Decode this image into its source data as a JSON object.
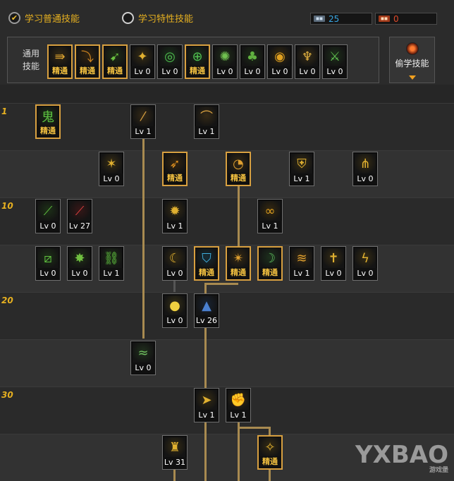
{
  "tabs": {
    "normal": "学习普通技能",
    "special": "学习特性技能"
  },
  "currency": [
    {
      "value": "25",
      "color": "#39a8e6"
    },
    {
      "value": "0",
      "color": "#e24a2a"
    }
  ],
  "common": {
    "label": "通用技能",
    "skills": [
      {
        "label": "精通",
        "gold": true,
        "icon": "dash-icon",
        "glyph": "⇛",
        "color": "#d8a030"
      },
      {
        "label": "精通",
        "gold": true,
        "icon": "crouch-icon",
        "glyph": "⤵",
        "color": "#c88020"
      },
      {
        "label": "精通",
        "gold": true,
        "icon": "kick-icon",
        "glyph": "➹",
        "color": "#6ac040"
      },
      {
        "label": "Lv 0",
        "gold": false,
        "icon": "wings-icon",
        "glyph": "✦",
        "color": "#e0b030"
      },
      {
        "label": "Lv 0",
        "gold": false,
        "icon": "target-icon",
        "glyph": "◎",
        "color": "#50c050"
      },
      {
        "label": "精通",
        "gold": true,
        "icon": "crosshair-icon",
        "glyph": "⊕",
        "color": "#50c050"
      },
      {
        "label": "Lv 0",
        "gold": false,
        "icon": "shout-icon",
        "glyph": "✺",
        "color": "#70c050"
      },
      {
        "label": "Lv 0",
        "gold": false,
        "icon": "mushroom-icon",
        "glyph": "♣",
        "color": "#60b040"
      },
      {
        "label": "Lv 0",
        "gold": false,
        "icon": "eye-icon",
        "glyph": "◉",
        "color": "#e0a020"
      },
      {
        "label": "Lv 0",
        "gold": false,
        "icon": "muscle-icon",
        "glyph": "♆",
        "color": "#e0b040"
      },
      {
        "label": "Lv 0",
        "gold": false,
        "icon": "spear-icon",
        "glyph": "⚔",
        "color": "#60c050"
      }
    ]
  },
  "steal": {
    "label": "偷学技能"
  },
  "level_markers": [
    "1",
    "10",
    "20",
    "30"
  ],
  "tree": [
    {
      "key": "r1c1",
      "label": "精通",
      "gold": true,
      "icon": "ghost-icon",
      "glyph": "鬼",
      "color": "#5cc040"
    },
    {
      "key": "r1c4",
      "label": "Lv 1",
      "gold": false,
      "icon": "claw-icon",
      "glyph": "⁄",
      "color": "#d8a040"
    },
    {
      "key": "r1c6",
      "label": "Lv 1",
      "gold": false,
      "icon": "slash-icon",
      "glyph": "⌒",
      "color": "#d8a040"
    },
    {
      "key": "r2c3",
      "label": "Lv 0",
      "gold": false,
      "icon": "fist-icon",
      "glyph": "✶",
      "color": "#e0b030"
    },
    {
      "key": "r2c5",
      "label": "精通",
      "gold": true,
      "icon": "sword-thrust-icon",
      "glyph": "➶",
      "color": "#e09020"
    },
    {
      "key": "r2c7",
      "label": "精通",
      "gold": true,
      "icon": "cyclone-icon",
      "glyph": "◔",
      "color": "#e0a030"
    },
    {
      "key": "r2c9",
      "label": "Lv 1",
      "gold": false,
      "icon": "shield-icon",
      "glyph": "⛨",
      "color": "#e0b030"
    },
    {
      "key": "r2c11",
      "label": "Lv 0",
      "gold": false,
      "icon": "triple-blade-icon",
      "glyph": "⋔",
      "color": "#e0b030"
    },
    {
      "key": "r3c1",
      "label": "Lv 0",
      "gold": false,
      "icon": "green-blade-icon",
      "glyph": "⟋",
      "color": "#60c040"
    },
    {
      "key": "r3c2",
      "label": "Lv 27",
      "gold": false,
      "icon": "red-blade-icon",
      "glyph": "⟋",
      "color": "#e04040"
    },
    {
      "key": "r3c5",
      "label": "Lv 1",
      "gold": false,
      "icon": "burst-icon",
      "glyph": "✹",
      "color": "#e0b030"
    },
    {
      "key": "r3c8",
      "label": "Lv 1",
      "gold": false,
      "icon": "spiral-icon",
      "glyph": "∞",
      "color": "#e0a020"
    },
    {
      "key": "r4c1",
      "label": "Lv 0",
      "gold": false,
      "icon": "green-slash-icon",
      "glyph": "⧄",
      "color": "#60c040"
    },
    {
      "key": "r4c2",
      "label": "Lv 0",
      "gold": false,
      "icon": "starburst-icon",
      "glyph": "✸",
      "color": "#70c040"
    },
    {
      "key": "r4c3",
      "label": "Lv 1",
      "gold": false,
      "icon": "chain-icon",
      "glyph": "⛓",
      "color": "#60c040"
    },
    {
      "key": "r4c5",
      "label": "Lv 0",
      "gold": false,
      "icon": "moon-slash-icon",
      "glyph": "☾",
      "color": "#e0b030"
    },
    {
      "key": "r4c6",
      "label": "精通",
      "gold": true,
      "icon": "mask-icon",
      "glyph": "⛉",
      "color": "#40b0e0"
    },
    {
      "key": "r4c7",
      "label": "精通",
      "gold": true,
      "icon": "rune-circle-icon",
      "glyph": "✴",
      "color": "#e0a030"
    },
    {
      "key": "r4c8",
      "label": "精通",
      "gold": true,
      "icon": "crescent-icon",
      "glyph": "☽",
      "color": "#60c060"
    },
    {
      "key": "r4c9",
      "label": "Lv 1",
      "gold": false,
      "icon": "wave-slash-icon",
      "glyph": "≋",
      "color": "#e0a030"
    },
    {
      "key": "r4c10",
      "label": "Lv 0",
      "gold": false,
      "icon": "cross-slash-icon",
      "glyph": "✝",
      "color": "#e0b030"
    },
    {
      "key": "r4c11",
      "label": "Lv 0",
      "gold": false,
      "icon": "flame-strike-icon",
      "glyph": "ϟ",
      "color": "#e0b030"
    },
    {
      "key": "r5c5",
      "label": "Lv 0",
      "gold": false,
      "icon": "sun-orb-icon",
      "glyph": "●",
      "color": "#f0d040"
    },
    {
      "key": "r5c6",
      "label": "Lv 26",
      "gold": false,
      "icon": "red-pagoda-icon",
      "glyph": "▲",
      "color": "#4a80d0"
    },
    {
      "key": "r6c4",
      "label": "Lv 0",
      "gold": false,
      "icon": "whirlwind-icon",
      "glyph": "≈",
      "color": "#70c060"
    },
    {
      "key": "r7c6",
      "label": "Lv 1",
      "gold": false,
      "icon": "rush-icon",
      "glyph": "➤",
      "color": "#e0b030"
    },
    {
      "key": "r7c7",
      "label": "Lv 1",
      "gold": false,
      "icon": "lunge-icon",
      "glyph": "✊",
      "color": "#e0b030"
    },
    {
      "key": "r8c5",
      "label": "Lv 31",
      "gold": false,
      "icon": "red-totem-icon",
      "glyph": "♜",
      "color": "#e0b030"
    },
    {
      "key": "r8c8",
      "label": "精通",
      "gold": true,
      "icon": "beast-icon",
      "glyph": "✧",
      "color": "#e0b030"
    }
  ],
  "watermark": {
    "main": "YXBAO",
    "sub": "游戏堡"
  }
}
